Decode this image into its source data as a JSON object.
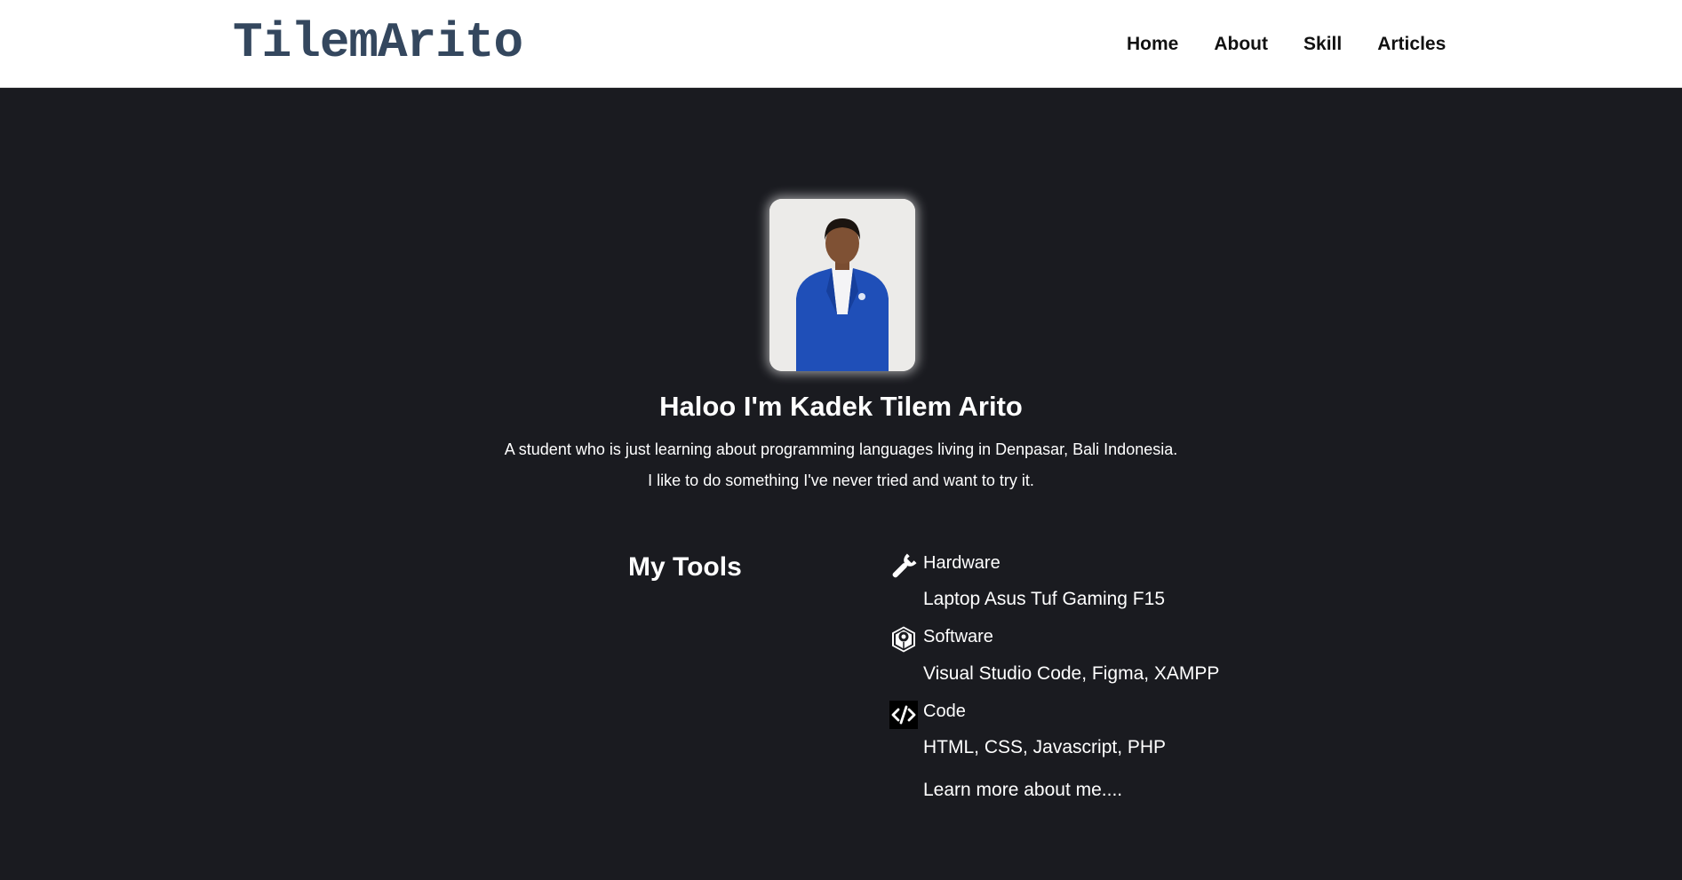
{
  "header": {
    "logo": "TilemArito",
    "nav": [
      "Home",
      "About",
      "Skill",
      "Articles"
    ]
  },
  "hero": {
    "title": "Haloo I'm Kadek Tilem Arito",
    "desc_line1": "A student who is just learning about programming languages living in Denpasar, Bali Indonesia.",
    "desc_line2": "I like to do something I've never tried and want to try it."
  },
  "tools": {
    "heading": "My Tools",
    "items": [
      {
        "icon": "wrench-icon",
        "label": "Hardware",
        "detail": "Laptop Asus Tuf Gaming F15"
      },
      {
        "icon": "software-box-icon",
        "label": "Software",
        "detail": "Visual Studio Code, Figma, XAMPP"
      },
      {
        "icon": "code-icon",
        "label": "Code",
        "detail": "HTML, CSS, Javascript, PHP"
      }
    ],
    "learn_more": "Learn more about me...."
  },
  "colors": {
    "page_background": "#1a1b20",
    "navbar_background": "#ffffff",
    "logo_color": "#34475e",
    "text_color": "#ffffff",
    "nav_text_color": "#111111"
  }
}
